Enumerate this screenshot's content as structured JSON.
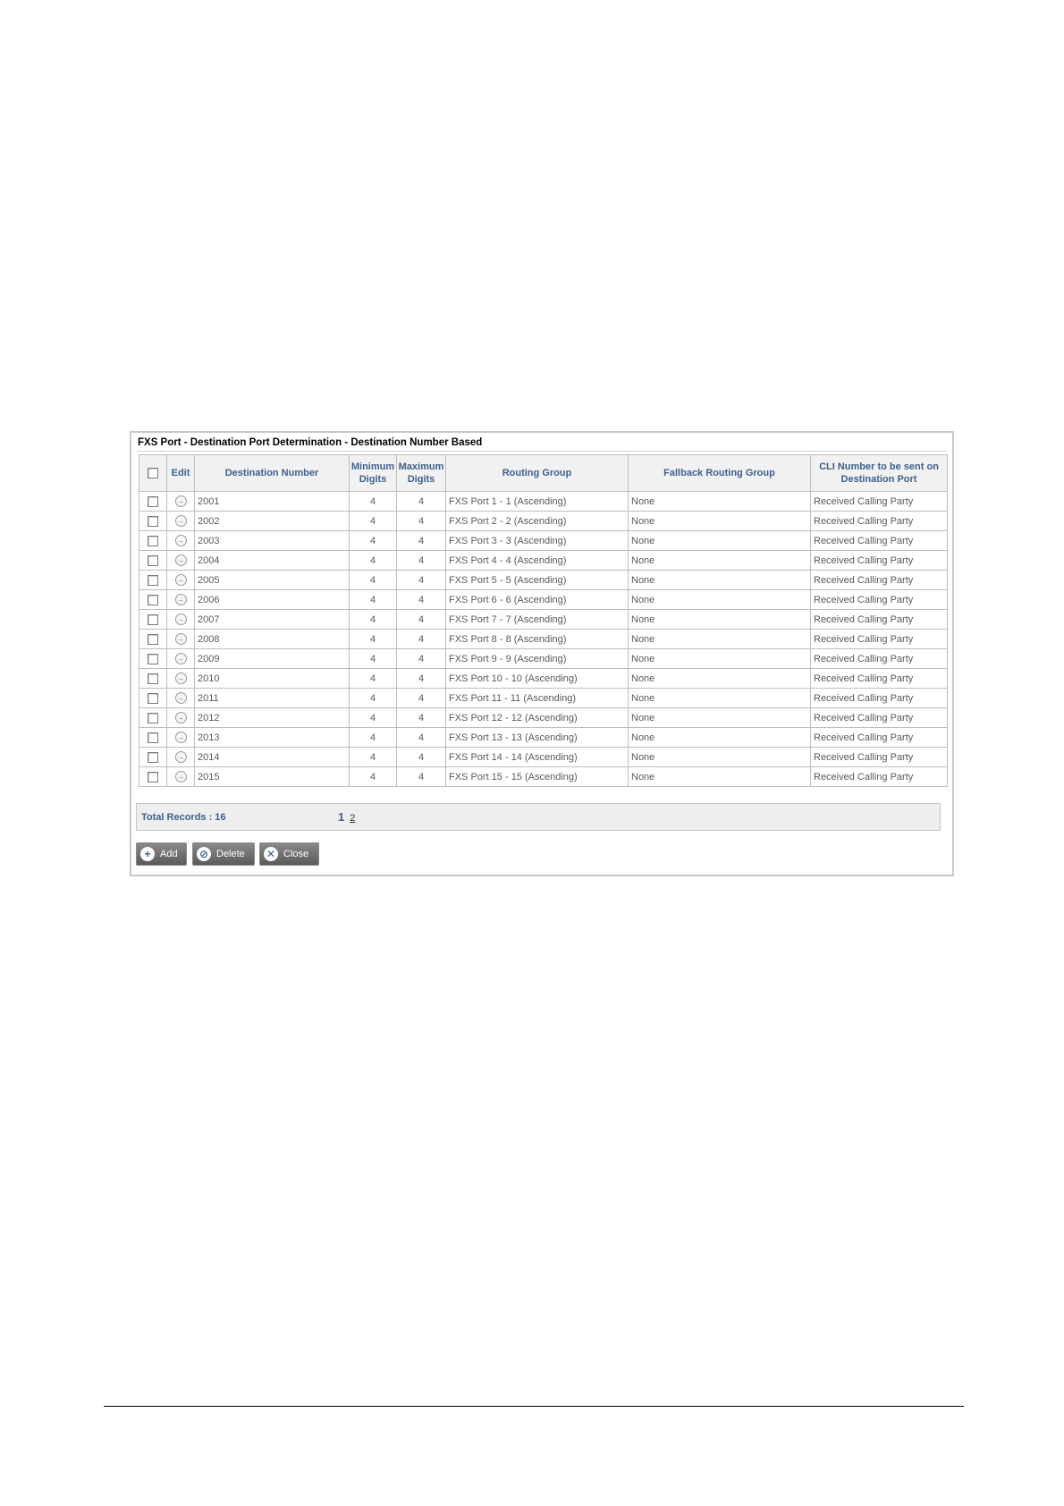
{
  "panel": {
    "title": "FXS Port - Destination Port Determination - Destination Number Based"
  },
  "table": {
    "columns": {
      "edit": "Edit",
      "destination_number": "Destination Number",
      "min_digits": "Minimum Digits",
      "max_digits": "Maximum Digits",
      "routing_group": "Routing Group",
      "fallback_routing_group": "Fallback Routing Group",
      "cli_number": "CLI Number to be sent on Destination Port"
    },
    "rows": [
      {
        "dest": "2001",
        "min": "4",
        "max": "4",
        "routing": "FXS Port 1 - 1 (Ascending)",
        "fallback": "None",
        "cli": "Received Calling Party"
      },
      {
        "dest": "2002",
        "min": "4",
        "max": "4",
        "routing": "FXS Port 2 - 2 (Ascending)",
        "fallback": "None",
        "cli": "Received Calling Party"
      },
      {
        "dest": "2003",
        "min": "4",
        "max": "4",
        "routing": "FXS Port 3 - 3 (Ascending)",
        "fallback": "None",
        "cli": "Received Calling Party"
      },
      {
        "dest": "2004",
        "min": "4",
        "max": "4",
        "routing": "FXS Port 4 - 4 (Ascending)",
        "fallback": "None",
        "cli": "Received Calling Party"
      },
      {
        "dest": "2005",
        "min": "4",
        "max": "4",
        "routing": "FXS Port 5 - 5 (Ascending)",
        "fallback": "None",
        "cli": "Received Calling Party"
      },
      {
        "dest": "2006",
        "min": "4",
        "max": "4",
        "routing": "FXS Port 6 - 6 (Ascending)",
        "fallback": "None",
        "cli": "Received Calling Party"
      },
      {
        "dest": "2007",
        "min": "4",
        "max": "4",
        "routing": "FXS Port 7 - 7 (Ascending)",
        "fallback": "None",
        "cli": "Received Calling Party"
      },
      {
        "dest": "2008",
        "min": "4",
        "max": "4",
        "routing": "FXS Port 8 - 8 (Ascending)",
        "fallback": "None",
        "cli": "Received Calling Party"
      },
      {
        "dest": "2009",
        "min": "4",
        "max": "4",
        "routing": "FXS Port 9 - 9 (Ascending)",
        "fallback": "None",
        "cli": "Received Calling Party"
      },
      {
        "dest": "2010",
        "min": "4",
        "max": "4",
        "routing": "FXS Port 10 - 10 (Ascending)",
        "fallback": "None",
        "cli": "Received Calling Party"
      },
      {
        "dest": "2011",
        "min": "4",
        "max": "4",
        "routing": "FXS Port 11 - 11 (Ascending)",
        "fallback": "None",
        "cli": "Received Calling Party"
      },
      {
        "dest": "2012",
        "min": "4",
        "max": "4",
        "routing": "FXS Port 12 - 12 (Ascending)",
        "fallback": "None",
        "cli": "Received Calling Party"
      },
      {
        "dest": "2013",
        "min": "4",
        "max": "4",
        "routing": "FXS Port 13 - 13 (Ascending)",
        "fallback": "None",
        "cli": "Received Calling Party"
      },
      {
        "dest": "2014",
        "min": "4",
        "max": "4",
        "routing": "FXS Port 14 - 14 (Ascending)",
        "fallback": "None",
        "cli": "Received Calling Party"
      },
      {
        "dest": "2015",
        "min": "4",
        "max": "4",
        "routing": "FXS Port 15 - 15 (Ascending)",
        "fallback": "None",
        "cli": "Received Calling Party"
      }
    ]
  },
  "footer": {
    "total_records": "Total Records : 16",
    "current_page": "1",
    "other_page": "2"
  },
  "buttons": {
    "add": "Add",
    "delete": "Delete",
    "close": "Close"
  },
  "icons": {
    "add": "plus-icon",
    "delete": "prohibited-icon",
    "close": "close-icon",
    "edit": "arrow-right-circle-icon"
  },
  "colors": {
    "header_text": "#3d5f8f",
    "button_bg": "#6e6e6e"
  }
}
